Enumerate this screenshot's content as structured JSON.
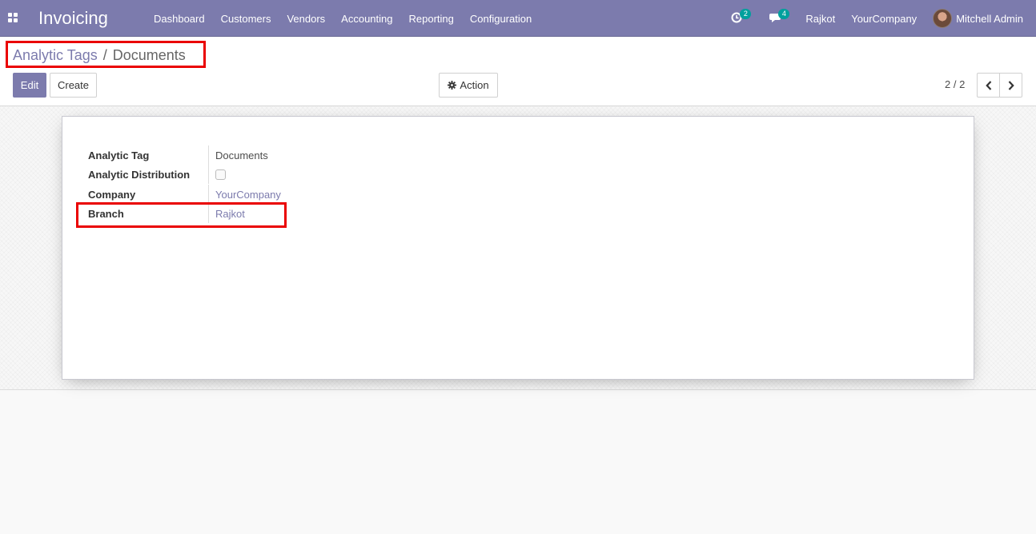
{
  "navbar": {
    "app_title": "Invoicing",
    "menu": [
      "Dashboard",
      "Customers",
      "Vendors",
      "Accounting",
      "Reporting",
      "Configuration"
    ],
    "activity_count": "2",
    "messages_count": "4",
    "branch": "Rajkot",
    "company": "YourCompany",
    "user_name": "Mitchell Admin"
  },
  "breadcrumb": {
    "parent": "Analytic Tags",
    "separator": "/",
    "current": "Documents"
  },
  "buttons": {
    "edit": "Edit",
    "create": "Create",
    "action": "Action"
  },
  "pager": {
    "value": "2 / 2"
  },
  "form": {
    "fields": [
      {
        "label": "Analytic Tag",
        "value": "Documents"
      },
      {
        "label": "Analytic Distribution",
        "value": false
      },
      {
        "label": "Company",
        "value": "YourCompany"
      },
      {
        "label": "Branch",
        "value": "Rajkot"
      }
    ]
  },
  "colors": {
    "brand": "#7c7bad",
    "badge": "#00a09d",
    "highlight": "#ea0000"
  },
  "icons": [
    "apps-icon",
    "activity-clock-icon",
    "chat-icon",
    "gear-icon",
    "chevron-left-icon",
    "chevron-right-icon"
  ]
}
